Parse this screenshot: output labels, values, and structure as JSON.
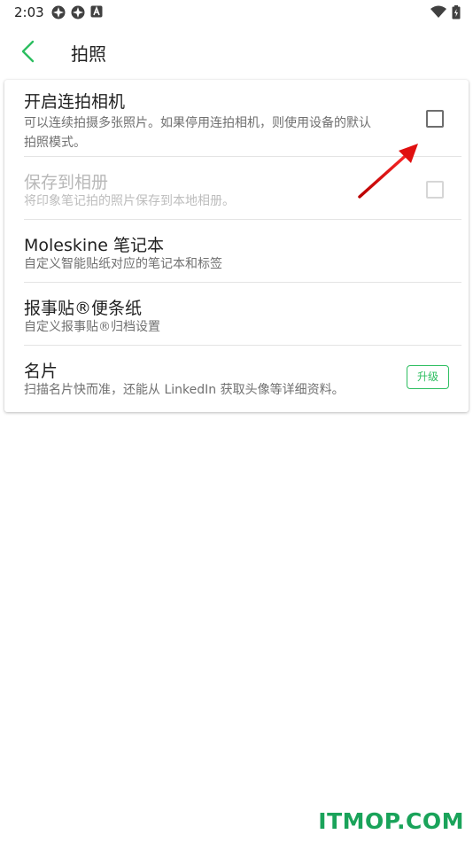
{
  "status_bar": {
    "time": "2:03",
    "left_icons": [
      "app-notification-icon",
      "app-notification-icon",
      "a-letter-icon"
    ],
    "right_icons": [
      "wifi-icon",
      "battery-icon"
    ]
  },
  "appbar": {
    "title": "拍照",
    "back_icon": "chevron-left-icon",
    "accent_color": "#2dbe60"
  },
  "settings": {
    "burst": {
      "title": "开启连拍相机",
      "subtitle_line1": "可以连续拍摄多张照片。如果停用连拍相机，则使用设备的默认",
      "subtitle_line2": "拍照模式。",
      "checked": false
    },
    "save_album": {
      "title": "保存到相册",
      "subtitle": "将印象笔记拍的照片保存到本地相册。",
      "checked": false,
      "enabled": false
    },
    "moleskine": {
      "title": "Moleskine 笔记本",
      "subtitle": "自定义智能贴纸对应的笔记本和标签"
    },
    "postit": {
      "title": "报事贴®便条纸",
      "subtitle": "自定义报事贴®归档设置"
    },
    "business_card": {
      "title": "名片",
      "subtitle": "扫描名片快而准，还能从 LinkedIn 获取头像等详细资料。",
      "upgrade_label": "升级"
    }
  },
  "watermark": "ITMOP.COM"
}
